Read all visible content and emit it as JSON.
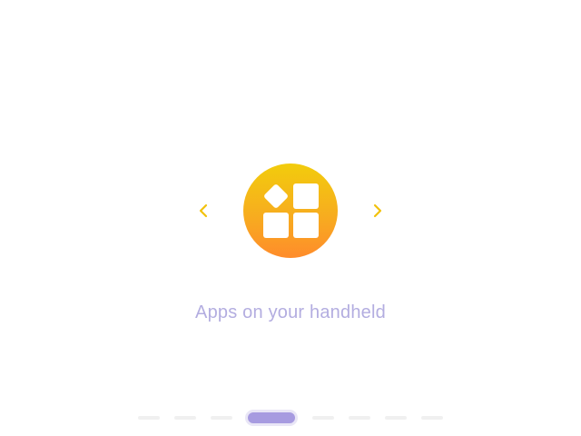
{
  "carousel": {
    "caption": "Apps on your handheld",
    "icon": "apps-grid-icon",
    "prev_icon": "chevron-left-icon",
    "next_icon": "chevron-right-icon",
    "accent_color": "#f2c20c",
    "caption_color": "#b3ade0"
  },
  "pager": {
    "page_count": 8,
    "active_page": 4,
    "active_color": "#a79be0",
    "inactive_color": "#f0f0f0"
  }
}
